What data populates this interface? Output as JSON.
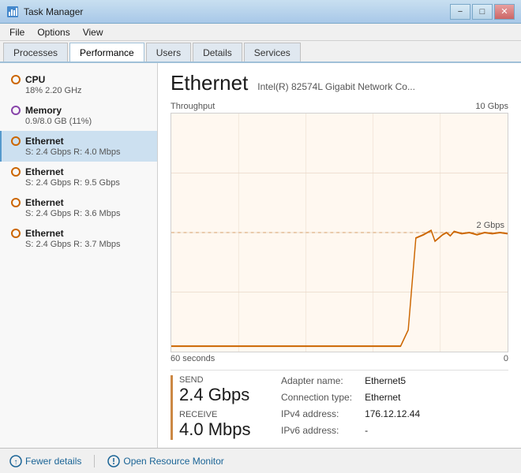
{
  "titleBar": {
    "title": "Task Manager",
    "minimize": "−",
    "maximize": "□",
    "close": "✕"
  },
  "menuBar": {
    "items": [
      "File",
      "Options",
      "View"
    ]
  },
  "tabs": [
    {
      "label": "Processes"
    },
    {
      "label": "Performance",
      "active": true
    },
    {
      "label": "Users"
    },
    {
      "label": "Details"
    },
    {
      "label": "Services"
    }
  ],
  "sidebar": {
    "items": [
      {
        "title": "CPU",
        "subtitle": "18% 2.20 GHz",
        "dotColor": "orange"
      },
      {
        "title": "Memory",
        "subtitle": "0.9/8.0 GB (11%)",
        "dotColor": "purple"
      },
      {
        "title": "Ethernet",
        "subtitle": "S: 2.4 Gbps R: 4.0 Mbps",
        "dotColor": "orange",
        "selected": true
      },
      {
        "title": "Ethernet",
        "subtitle": "S: 2.4 Gbps R: 9.5 Gbps",
        "dotColor": "orange"
      },
      {
        "title": "Ethernet",
        "subtitle": "S: 2.4 Gbps R: 3.6 Mbps",
        "dotColor": "orange"
      },
      {
        "title": "Ethernet",
        "subtitle": "S: 2.4 Gbps R: 3.7 Mbps",
        "dotColor": "orange"
      }
    ]
  },
  "detail": {
    "title": "Ethernet",
    "subtitle": "Intel(R) 82574L Gigabit Network Co...",
    "chart": {
      "throughputLabel": "Throughput",
      "maxLabel": "10 Gbps",
      "timeLabel": "60 seconds",
      "zeroLabel": "0",
      "midLabel": "2 Gbps"
    },
    "stats": {
      "sendLabel": "Send",
      "sendValue": "2.4 Gbps",
      "receiveLabel": "Receive",
      "receiveValue": "4.0 Mbps",
      "adapterNameLabel": "Adapter name:",
      "adapterNameValue": "Ethernet5",
      "connectionTypeLabel": "Connection type:",
      "connectionTypeValue": "Ethernet",
      "ipv4Label": "IPv4 address:",
      "ipv4Value": "176.12.12.44",
      "ipv6Label": "IPv6 address:",
      "ipv6Value": "-"
    }
  },
  "bottomBar": {
    "fewerDetails": "Fewer details",
    "openResourceMonitor": "Open Resource Monitor"
  }
}
